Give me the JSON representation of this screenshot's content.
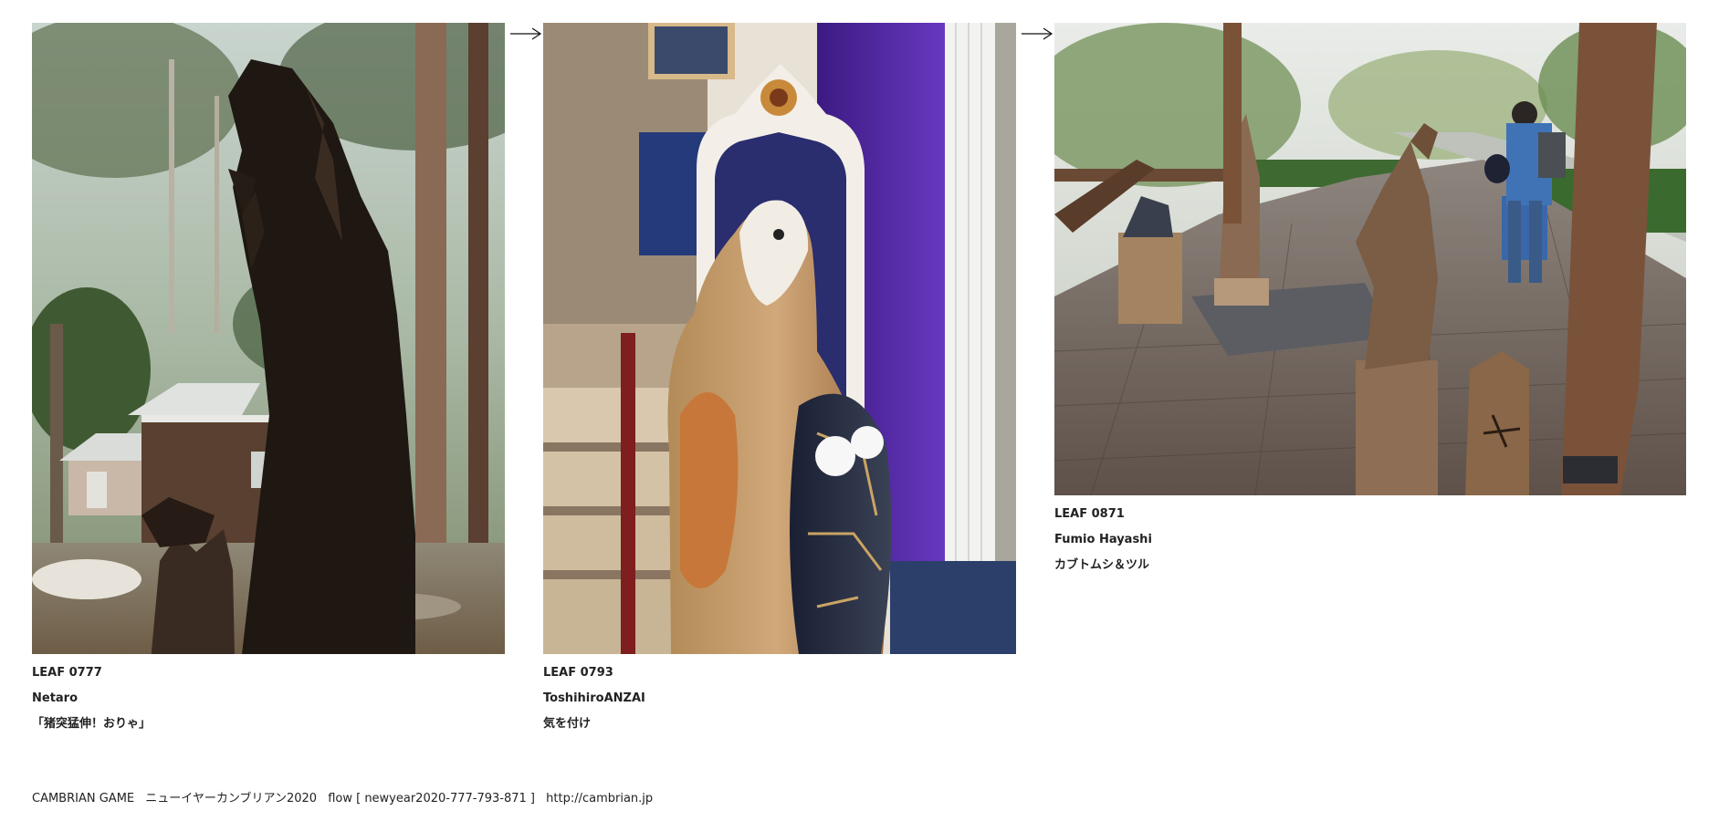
{
  "leaves": [
    {
      "id": "LEAF 0777",
      "author": "Netaro",
      "title": "「猪突猛伸！おりゃ」"
    },
    {
      "id": "LEAF 0793",
      "author": "ToshihiroANZAI",
      "title": "気を付け"
    },
    {
      "id": "LEAF 0871",
      "author": "Fumio Hayashi",
      "title": "カブトムシ＆ツル"
    }
  ],
  "footer": {
    "brand": "CAMBRIAN GAME",
    "event": "ニューイヤーカンブリアン2020",
    "flow": "flow [ newyear2020-777-793-871 ]",
    "url": "http://cambrian.jp"
  }
}
